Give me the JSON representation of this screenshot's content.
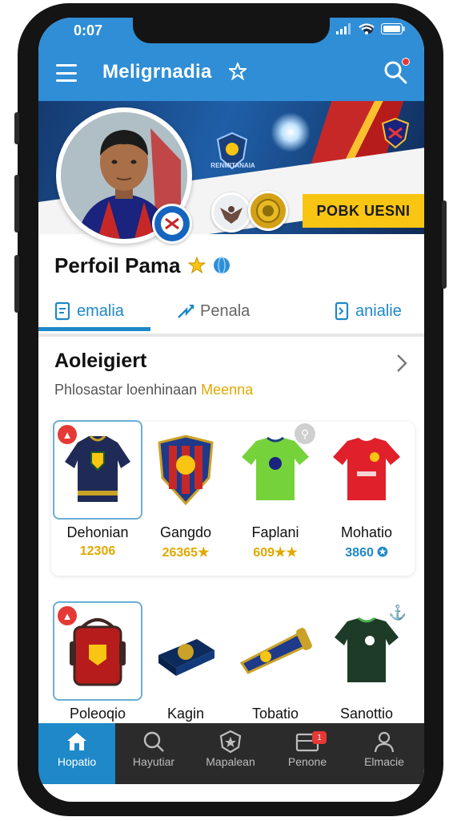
{
  "status_bar": {
    "time": "0:07"
  },
  "header": {
    "title": "Meligrnadia"
  },
  "banner": {
    "crest_text": "RENMITANAIA",
    "cta_label": "POBK UESNI"
  },
  "profile": {
    "name": "Perfoil Pama"
  },
  "tabs": [
    {
      "label": "emalia",
      "icon": "document-icon",
      "active": true
    },
    {
      "label": "Penala",
      "icon": "share-icon",
      "active": false
    },
    {
      "label": "anialie",
      "icon": "info-box-icon",
      "active": false
    }
  ],
  "section": {
    "title": "Aoleigiert",
    "subtitle_main": "Phlosastar loenhinaan",
    "subtitle_accent": "Meenna"
  },
  "items_row1": [
    {
      "name": "Dehonian",
      "price": "12306",
      "price_color": "#e0a800",
      "selected": true,
      "icon": "jacket-icon"
    },
    {
      "name": "Gangdo",
      "price": "26365★",
      "price_color": "#e0a800",
      "selected": false,
      "icon": "shield-icon"
    },
    {
      "name": "Faplani",
      "price": "609★★",
      "price_color": "#e0a800",
      "selected": false,
      "icon": "green-jersey-icon"
    },
    {
      "name": "Mohatio",
      "price": "3860 ✪",
      "price_color": "#1e88c8",
      "selected": false,
      "icon": "red-jersey-icon"
    }
  ],
  "items_row2": [
    {
      "name": "Poleoqio",
      "selected": true,
      "icon": "bag-icon"
    },
    {
      "name": "Kagin",
      "selected": false,
      "icon": "card-box-icon"
    },
    {
      "name": "Tobatio",
      "selected": false,
      "icon": "scarf-icon"
    },
    {
      "name": "Sanottio",
      "selected": false,
      "icon": "dark-jersey-icon"
    }
  ],
  "bottom_nav": [
    {
      "label": "Hopatio",
      "icon": "home-icon",
      "active": true
    },
    {
      "label": "Hayutiar",
      "icon": "search-icon",
      "active": false
    },
    {
      "label": "Mapalean",
      "icon": "badge-icon",
      "active": false
    },
    {
      "label": "Penone",
      "icon": "inbox-icon",
      "active": false,
      "badge": "1"
    },
    {
      "label": "Elmacie",
      "icon": "person-icon",
      "active": false
    }
  ],
  "colors": {
    "accent": "#1e88c8",
    "header": "#2f8ed6",
    "cta": "#f9c513",
    "nav_bg": "#2b2b2b"
  }
}
